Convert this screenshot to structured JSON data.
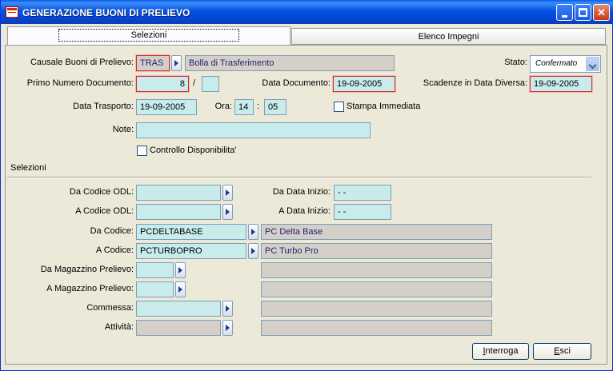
{
  "window": {
    "title": "GENERAZIONE BUONI DI PRELIEVO"
  },
  "tabs": [
    {
      "label": "Selezioni"
    },
    {
      "label": "Elenco Impegni"
    }
  ],
  "form": {
    "causale_label": "Causale Buoni di Prelievo:",
    "causale_code": "TRAS",
    "causale_desc": "Bolla di Trasferimento",
    "stato_label": "Stato:",
    "stato_value": "Confermato",
    "primo_numero_label": "Primo Numero Documento:",
    "primo_numero_value": "8",
    "slash": "/",
    "serie_value": "",
    "data_documento_label": "Data Documento:",
    "data_documento_value": "19-09-2005",
    "scadenze_label": "Scadenze in Data Diversa:",
    "scadenze_value": "19-09-2005",
    "data_trasporto_label": "Data Trasporto:",
    "data_trasporto_value": "19-09-2005",
    "ora_label": "Ora:",
    "ora_hh": "14",
    "ora_sep": ":",
    "ora_mm": "05",
    "stampa_label": "Stampa Immediata",
    "note_label": "Note:",
    "note_value": "",
    "controllo_label": "Controllo Disponibilita'"
  },
  "selezioni": {
    "section_label": "Selezioni",
    "da_codice_odl_label": "Da Codice ODL:",
    "a_codice_odl_label": "A Codice ODL:",
    "da_data_inizio_label": "Da Data Inizio:",
    "da_data_inizio_value": "- -",
    "a_data_inizio_label": "A Data Inizio:",
    "a_data_inizio_value": "- -",
    "da_codice_label": "Da Codice:",
    "da_codice_value": "PCDELTABASE",
    "da_codice_desc": "PC Delta Base",
    "a_codice_label": "A Codice:",
    "a_codice_value": "PCTURBOPRO",
    "a_codice_desc": "PC Turbo Pro",
    "da_magazzino_label": "Da Magazzino Prelievo:",
    "a_magazzino_label": "A Magazzino Prelievo:",
    "commessa_label": "Commessa:",
    "attivita_label": "Attività:"
  },
  "buttons": {
    "interroga_accel": "I",
    "interroga_rest": "nterroga",
    "esci_accel": "E",
    "esci_rest": "sci"
  }
}
